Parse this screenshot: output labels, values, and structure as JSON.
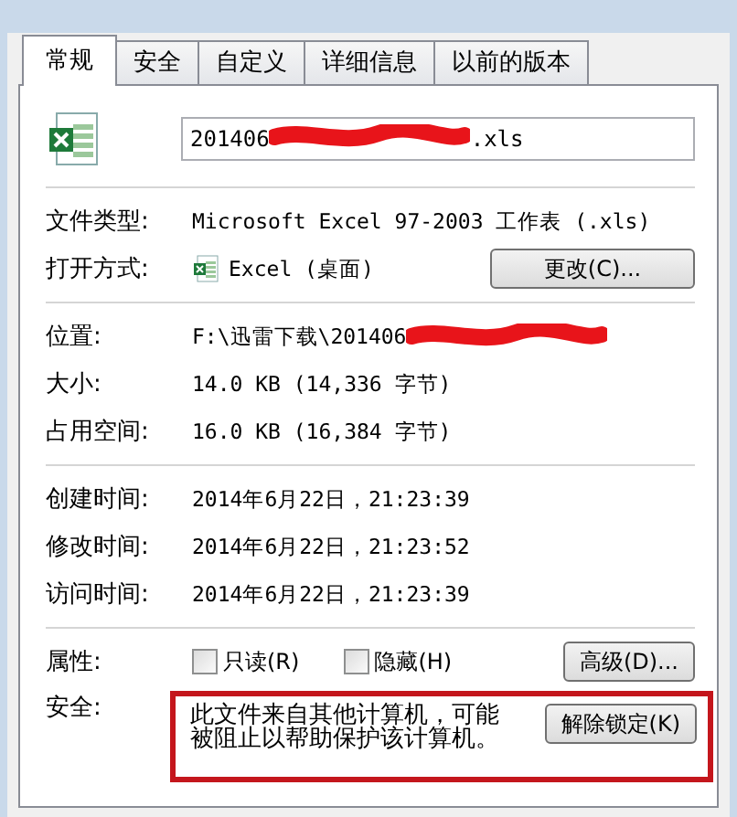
{
  "tabs": [
    {
      "label": "常规",
      "selected": true
    },
    {
      "label": "安全",
      "selected": false
    },
    {
      "label": "自定义",
      "selected": false
    },
    {
      "label": "详细信息",
      "selected": false
    },
    {
      "label": "以前的版本",
      "selected": false
    }
  ],
  "file": {
    "name_start": "201406",
    "name_end": ".xls",
    "redacted": true
  },
  "type_row": {
    "label": "文件类型:",
    "value": "Microsoft Excel 97-2003 工作表 (.xls)"
  },
  "open_with": {
    "label": "打开方式:",
    "app": "Excel (桌面)",
    "button": "更改(C)..."
  },
  "size_rows": [
    {
      "label": "位置:",
      "value": "F:\\迅雷下载\\201406",
      "redacted": true
    },
    {
      "label": "大小:",
      "value": "14.0 KB (14,336 字节)",
      "redacted": false
    },
    {
      "label": "占用空间:",
      "value": "16.0 KB (16,384 字节)",
      "redacted": false
    }
  ],
  "time_rows": [
    {
      "label": "创建时间:",
      "value": "2014年6月22日，21:23:39"
    },
    {
      "label": "修改时间:",
      "value": "2014年6月22日，21:23:52"
    },
    {
      "label": "访问时间:",
      "value": "2014年6月22日，21:23:39"
    }
  ],
  "attributes": {
    "label": "属性:",
    "checkboxes": [
      {
        "label": "只读(R)",
        "checked": false
      },
      {
        "label": "隐藏(H)",
        "checked": false
      }
    ],
    "button": "高级(D)..."
  },
  "security": {
    "label": "安全:",
    "message": "此文件来自其他计算机，可能被阻止以帮助保护该计算机。",
    "button": "解除锁定(K)",
    "highlighted": true
  }
}
